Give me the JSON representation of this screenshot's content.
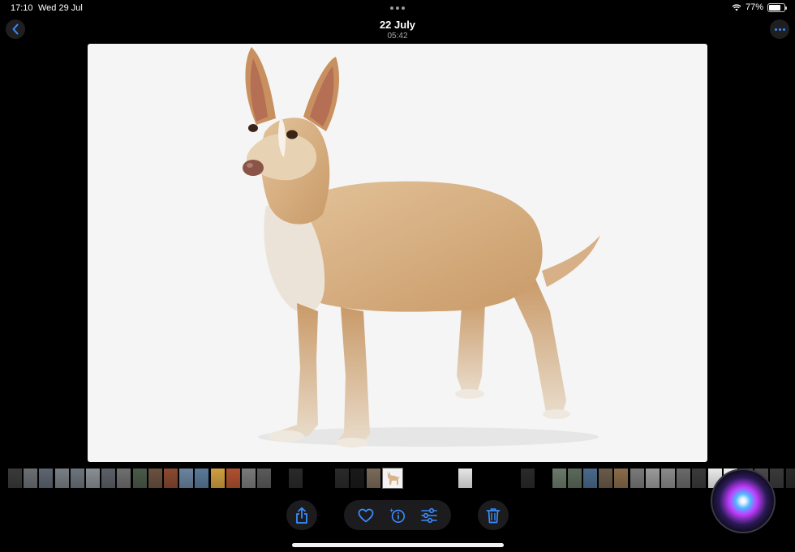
{
  "status": {
    "time": "17:10",
    "date": "Wed 29 Jul",
    "battery_percent": "77%",
    "battery_level": 0.77
  },
  "header": {
    "title": "22 July",
    "subtitle": "05:42"
  },
  "icons": {
    "back": "chevron-left-icon",
    "more": "ellipsis-icon",
    "share": "share-icon",
    "favorite": "heart-icon",
    "info": "info-sparkle-icon",
    "adjust": "sliders-icon",
    "delete": "trash-icon"
  },
  "colors": {
    "accent": "#3a8dff",
    "background": "#000000",
    "photo_background": "#f5f5f5"
  },
  "filmstrip": {
    "selected_index": 24,
    "thumb_colors": [
      "#3a3a3a",
      "#6b6f74",
      "#5d6570",
      "#7a7f85",
      "#6d747c",
      "#8a8f94",
      "#5b6068",
      "#6f6f6f",
      "#4a5a4a",
      "#6a5140",
      "#8a4a30",
      "#6a84a0",
      "#5a7a9a",
      "#d0a040",
      "#b05030",
      "#7a7a7a",
      "#5a5a5a",
      "#222",
      "#2a2a2a",
      "#b33",
      "#c44",
      "#2a2a2a",
      "#1a1a1a",
      "#7a6a5a",
      "#f3f3f3",
      "#333",
      "#444",
      "#555",
      "#e6e6e6",
      "#222",
      "#eee",
      "#ddd",
      "#2a2a2a",
      "#444",
      "#6a7a6a",
      "#5a6a5a",
      "#4a6a8a",
      "#6a5a4a",
      "#8a6a4a",
      "#7a7a7a",
      "#9a9a9a",
      "#8a8a8a",
      "#6a6a6a",
      "#3a3a3a",
      "#eaeaea",
      "#f0f0f0",
      "#5a5a5a",
      "#4a4a4a",
      "#3a3a3a",
      "#2a2a2a"
    ]
  }
}
